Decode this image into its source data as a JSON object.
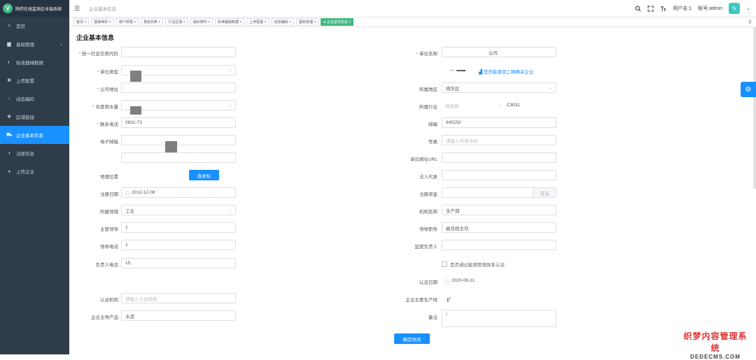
{
  "app": {
    "title": "陕药在线监测企业端系统",
    "logo_letter": "V"
  },
  "sidebar": {
    "items": [
      {
        "label": "首页",
        "icon": "share-icon",
        "glyph": "<"
      },
      {
        "label": "基础管理",
        "icon": "chart-icon",
        "glyph": "▆",
        "arrow": "⌄"
      },
      {
        "label": "标准器械数据",
        "icon": "circle-half-icon",
        "glyph": "◐"
      },
      {
        "label": "上传配置",
        "icon": "gear-icon",
        "glyph": "✱"
      },
      {
        "label": "动态编码",
        "icon": "code-icon",
        "glyph": "▫"
      },
      {
        "label": "区域链接",
        "icon": "move-icon",
        "glyph": "✚"
      },
      {
        "label": "企业基本信息",
        "icon": "car-icon",
        "glyph": "⛟"
      },
      {
        "label": "注册信息",
        "icon": "circle-half-icon",
        "glyph": "◑"
      },
      {
        "label": "上传企业",
        "icon": "user-icon",
        "glyph": "◕"
      }
    ]
  },
  "header": {
    "menu_icon": "☰",
    "breadcrumb": "企业基本信息",
    "user_label": "用户名:1",
    "account_label": "账号:admin",
    "avatar_glyph": "✎",
    "caret": "⌄"
  },
  "tags": [
    "首页",
    "基础维护",
    "用户管理",
    "角色列表",
    "行业区域",
    "组织架构",
    "标准器械数据",
    "上传配置",
    "动态编码",
    "图标管理",
    "● 企业基本信息"
  ],
  "tags_more": "⠿",
  "form": {
    "title": "企业基本信息",
    "labels": {
      "credit_code": "统一社会信用代码",
      "unit_name": "单位名称",
      "unit_type": "单位类型",
      "address": "公司地址",
      "region": "所属地区",
      "annual_level": "年度用水量",
      "industry": "所属行业",
      "phone": "联系电话",
      "postcode": "邮编",
      "email": "电子邮箱",
      "fax": "传真",
      "url": "单位网址URL",
      "geo": "地理位置",
      "legal_rep": "法人代表",
      "reg_date": "注册日期",
      "reg_capital": "注册资金",
      "sector": "所属领域",
      "org_name": "机构名称",
      "leader": "主管领导",
      "leader_title": "领导职务",
      "leader_phone": "领导电话",
      "supervisor": "监管负责人",
      "contact_phone": "负责人电话",
      "cert_date": "认证日期",
      "cert_org": "认证机构",
      "main_product_line": "企业主要生产线",
      "main_product": "企业主导产品",
      "remark": "备注"
    },
    "values": {
      "unit_name": "公司",
      "region": "闻东区",
      "industry_code": "C3011",
      "industry_placeholder": "请选择",
      "phone": "0831-73",
      "postcode": "645250",
      "fax_placeholder": "请输入传真号码",
      "url_partial": "",
      "geo_button": "选坐标",
      "reg_date": "2012-12-08",
      "capital_unit": "万元",
      "sector": "工业",
      "org_name": "生产部",
      "leader": "1",
      "leader_title": "副总经主任",
      "leader_phone": "1",
      "contact_phone": "15.",
      "cert_checkbox": "是否通过能源管理体系认证",
      "energy_link": "是否能源双工精确关企业",
      "cert_date": "2020-06-11",
      "cert_org_placeholder": "请输入认证机构",
      "main_product_line": "扩",
      "main_product": "水泥",
      "remark": "!"
    },
    "submit": "确定修改"
  },
  "watermark": {
    "line1": "织梦内容管理系统",
    "line2": "DEDECMS.COM"
  }
}
